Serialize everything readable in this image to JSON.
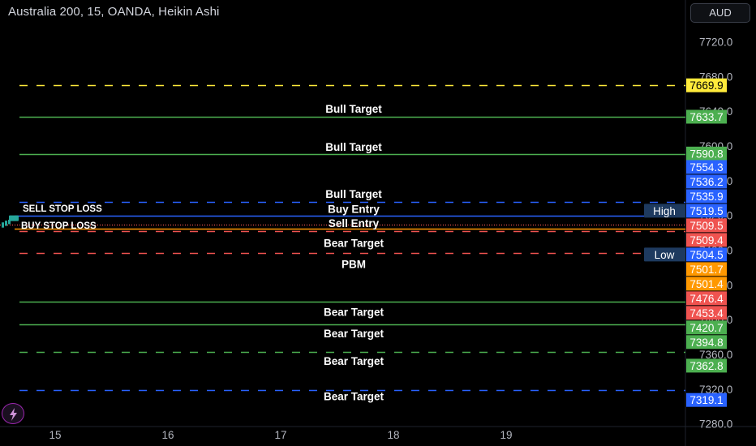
{
  "header": {
    "title": "Australia 200, 15, OANDA, Heikin Ashi",
    "currency": "AUD"
  },
  "colors": {
    "background": "#000000",
    "bull_target": "#4caf50",
    "blue": "#2962ff",
    "red": "#ef5350",
    "orange": "#ff9800",
    "yellow": "#ffeb3b"
  },
  "chart_data": {
    "type": "line",
    "ylim": [
      7275,
      7742
    ],
    "y_ticks": [
      7720.0,
      7680.0,
      7640.0,
      7600.0,
      7560.0,
      7520.0,
      7480.0,
      7440.0,
      7400.0,
      7360.0,
      7320.0,
      7280.0
    ],
    "y_tick_labels": [
      "7720.0",
      "7680.0",
      "7640.0",
      "7600.0",
      "7560.0",
      "7520.0",
      "7480.0",
      "7440.0",
      "7400.0",
      "7360.0",
      "7320.0",
      "7280.0"
    ],
    "x_tick_labels": [
      "15",
      "16",
      "17",
      "18",
      "19"
    ],
    "levels": [
      {
        "value": 7669.9,
        "style": "dashed",
        "color": "#ffeb3b"
      },
      {
        "value": 7633.7,
        "style": "solid",
        "color": "#4caf50"
      },
      {
        "value": 7590.8,
        "style": "solid",
        "color": "#4caf50"
      },
      {
        "value": 7535.9,
        "style": "dashed",
        "color": "#2962ff"
      },
      {
        "value": 7519.5,
        "style": "solid",
        "color": "#2962ff"
      },
      {
        "value": 7509.4,
        "style": "dotted",
        "color": "#ef5350"
      },
      {
        "value": 7504.5,
        "style": "solid",
        "color": "#ff9800"
      },
      {
        "value": 7501.7,
        "style": "dashed",
        "color": "#ef5350"
      },
      {
        "value": 7476.4,
        "style": "dashed",
        "color": "#ef5350"
      },
      {
        "value": 7420.7,
        "style": "solid",
        "color": "#4caf50"
      },
      {
        "value": 7394.8,
        "style": "solid",
        "color": "#4caf50"
      },
      {
        "value": 7362.8,
        "style": "dashed",
        "color": "#4caf50"
      },
      {
        "value": 7319.1,
        "style": "dashed",
        "color": "#2962ff"
      }
    ],
    "annotations": [
      {
        "text": "Bull Target",
        "value": 7643
      },
      {
        "text": "Bull Target",
        "value": 7599
      },
      {
        "text": "Bull Target",
        "value": 7545
      },
      {
        "text": "Buy Entry",
        "value": 7527.5
      },
      {
        "text": "Sell Entry",
        "value": 7511.5
      },
      {
        "text": "Bear Target",
        "value": 7488.5
      },
      {
        "text": "PBM",
        "value": 7464
      },
      {
        "text": "Bear Target",
        "value": 7409
      },
      {
        "text": "Bear Target",
        "value": 7384.5
      },
      {
        "text": "Bear Target",
        "value": 7352.5
      },
      {
        "text": "Bear Target",
        "value": 7312
      }
    ],
    "left_labels": [
      {
        "text": "SELL STOP LOSS",
        "value": 7528
      },
      {
        "text": "BUY STOP LOSS",
        "value": 7508.7
      }
    ],
    "price_tags": [
      {
        "text": "7669.9",
        "value": 7669.9,
        "bg": "#ffeb3b",
        "fg": "#000000"
      },
      {
        "text": "7633.7",
        "value": 7633.7,
        "bg": "#4caf50",
        "fg": "#ffffff"
      },
      {
        "text": "7590.8",
        "value": 7591.3,
        "bg": "#4caf50",
        "fg": "#ffffff"
      },
      {
        "text": "7554.3",
        "value": 7575.8,
        "bg": "#2962ff",
        "fg": "#ffffff"
      },
      {
        "text": "7536.2",
        "value": 7559.0,
        "bg": "#2962ff",
        "fg": "#ffffff"
      },
      {
        "text": "7535.9",
        "value": 7542.2,
        "bg": "#2962ff",
        "fg": "#ffffff"
      },
      {
        "text": "7519.5",
        "value": 7525.4,
        "bg": "#2962ff",
        "fg": "#ffffff"
      },
      {
        "text": "7509.5",
        "value": 7508.6,
        "bg": "#ef5350",
        "fg": "#ffffff"
      },
      {
        "text": "7509.4",
        "value": 7491.8,
        "bg": "#ef5350",
        "fg": "#ffffff"
      },
      {
        "text": "7504.5",
        "value": 7475.0,
        "bg": "#2962ff",
        "fg": "#ffffff"
      },
      {
        "text": "7501.7",
        "value": 7458.2,
        "bg": "#ff9800",
        "fg": "#ffffff"
      },
      {
        "text": "7501.4",
        "value": 7441.4,
        "bg": "#ff9800",
        "fg": "#ffffff"
      },
      {
        "text": "7476.4",
        "value": 7424.6,
        "bg": "#ef5350",
        "fg": "#ffffff"
      },
      {
        "text": "7453.4",
        "value": 7407.8,
        "bg": "#ef5350",
        "fg": "#ffffff"
      },
      {
        "text": "7420.7",
        "value": 7391.0,
        "bg": "#4caf50",
        "fg": "#ffffff"
      },
      {
        "text": "7394.8",
        "value": 7374.2,
        "bg": "#4caf50",
        "fg": "#ffffff"
      },
      {
        "text": "7362.8",
        "value": 7347.0,
        "bg": "#4caf50",
        "fg": "#ffffff"
      },
      {
        "text": "7319.1",
        "value": 7307.5,
        "bg": "#2962ff",
        "fg": "#ffffff"
      }
    ],
    "side_labels": [
      {
        "text": "High",
        "value": 7525.4
      },
      {
        "text": "Low",
        "value": 7475.0
      }
    ]
  }
}
